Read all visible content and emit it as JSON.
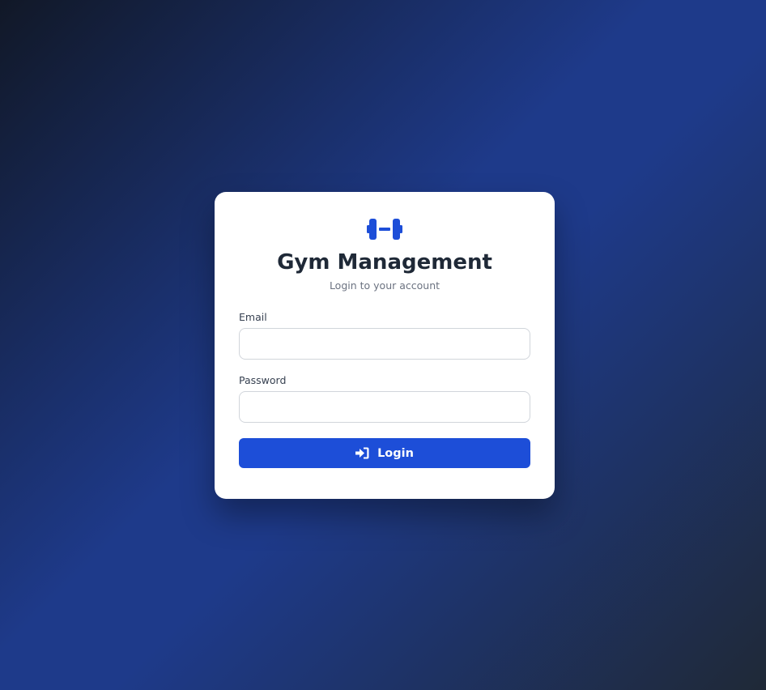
{
  "app": {
    "title": "Gym Management",
    "subtitle": "Login to your account",
    "logo_icon": "dumbbell-icon"
  },
  "form": {
    "email_label": "Email",
    "email_value": "",
    "email_placeholder": "",
    "password_label": "Password",
    "password_value": "",
    "password_placeholder": "",
    "submit_label": "Login",
    "submit_icon": "sign-in-icon"
  },
  "colors": {
    "accent": "#1d4ed8",
    "background_start": "#111827",
    "background_mid": "#1e3a8a",
    "background_end": "#1f2937",
    "title_text": "#1f2937"
  }
}
